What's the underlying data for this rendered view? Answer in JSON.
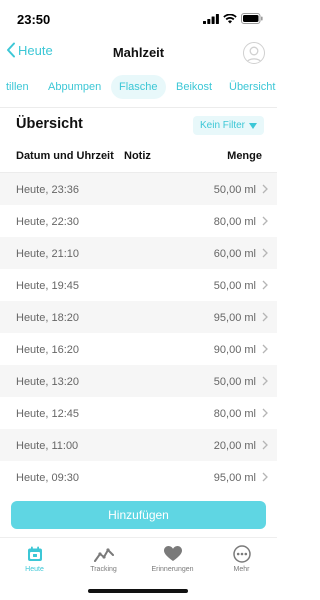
{
  "status": {
    "time": "23:50"
  },
  "nav": {
    "back_label": "Heute",
    "title": "Mahlzeit"
  },
  "tabs": [
    {
      "label": "tillen",
      "active": false
    },
    {
      "label": "Abpumpen",
      "active": false
    },
    {
      "label": "Flasche",
      "active": true
    },
    {
      "label": "Beikost",
      "active": false
    },
    {
      "label": "Übersicht",
      "active": false
    }
  ],
  "overview": {
    "title": "Übersicht",
    "filter_label": "Kein Filter"
  },
  "columns": {
    "date": "Datum und Uhrzeit",
    "note": "Notiz",
    "amount": "Menge"
  },
  "entries": [
    {
      "date": "Heute, 23:36",
      "amount": "50,00 ml"
    },
    {
      "date": "Heute, 22:30",
      "amount": "80,00 ml"
    },
    {
      "date": "Heute, 21:10",
      "amount": "60,00 ml"
    },
    {
      "date": "Heute, 19:45",
      "amount": "50,00 ml"
    },
    {
      "date": "Heute, 18:20",
      "amount": "95,00 ml"
    },
    {
      "date": "Heute, 16:20",
      "amount": "90,00 ml"
    },
    {
      "date": "Heute, 13:20",
      "amount": "50,00 ml"
    },
    {
      "date": "Heute, 12:45",
      "amount": "80,00 ml"
    },
    {
      "date": "Heute, 11:00",
      "amount": "20,00 ml"
    },
    {
      "date": "Heute, 09:30",
      "amount": "95,00 ml"
    }
  ],
  "add_button": {
    "label": "Hinzufügen"
  },
  "tabbar": [
    {
      "label": "Heute",
      "icon": "calendar-icon",
      "active": true
    },
    {
      "label": "Tracking",
      "icon": "chart-line-icon",
      "active": false
    },
    {
      "label": "Erinnerungen",
      "icon": "heart-icon",
      "active": false
    },
    {
      "label": "Mehr",
      "icon": "more-icon",
      "active": false
    }
  ],
  "colors": {
    "accent": "#3cc7d6",
    "button": "#5fd6e3",
    "tab_active_bg": "#e8f8fa"
  }
}
